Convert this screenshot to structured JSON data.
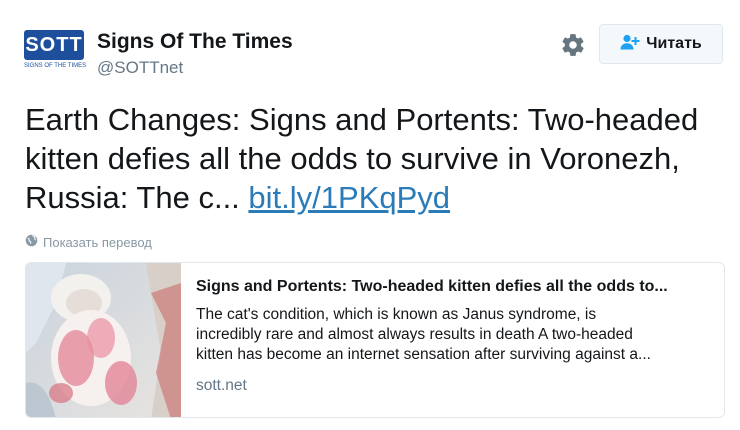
{
  "user": {
    "logo_text": "SOTT",
    "logo_subtext": "SIGNS OF THE TIMES",
    "name": "Signs Of The Times",
    "handle": "@SOTTnet"
  },
  "actions": {
    "settings_icon": "gear-icon",
    "follow_icon": "add-user-icon",
    "follow_label": "Читать"
  },
  "tweet": {
    "text": "Earth Changes: Signs and Portents: Two-headed kitten defies all the odds to survive in Voronezh, Russia: The c...",
    "link": "bit.ly/1PKqPyd",
    "translate": "Показать перевод"
  },
  "card": {
    "title": "Signs and Portents: Two-headed kitten defies all the odds to...",
    "desc_line1": "The cat's condition, which is known as Janus syndrome, is",
    "desc_line2": "incredibly rare and almost always results in death A two-headed",
    "desc_line3": "kitten has become an internet sensation after surviving against a...",
    "domain": "sott.net"
  },
  "colors": {
    "link": "#2b7bb9",
    "logo": "#1d4f9c",
    "muted": "#657786"
  }
}
